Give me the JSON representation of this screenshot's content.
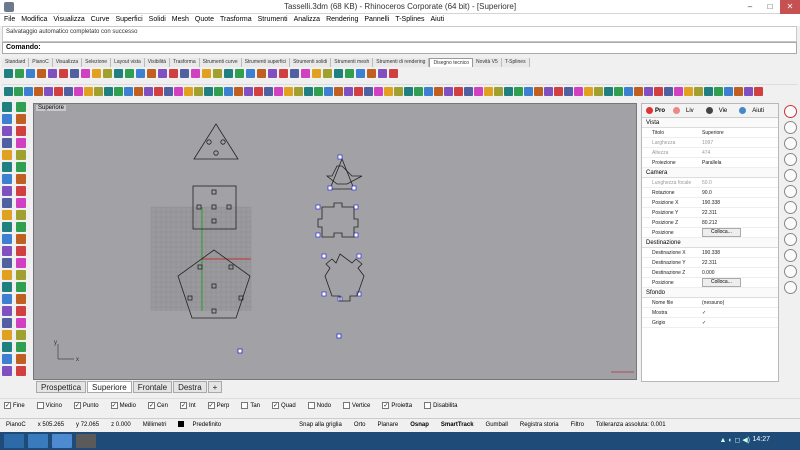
{
  "window": {
    "title": "Tasselli.3dm (68 KB) - Rhinoceros Corporate (64 bit) - [Superiore]",
    "min": "–",
    "max": "□",
    "close": "✕"
  },
  "menu": [
    "File",
    "Modifica",
    "Visualizza",
    "Curve",
    "Superfici",
    "Solidi",
    "Mesh",
    "Quote",
    "Trasforma",
    "Strumenti",
    "Analizza",
    "Rendering",
    "Pannelli",
    "T-Splines",
    "Aiuti"
  ],
  "history": "Salvataggio automatico completato con successo",
  "command": {
    "label": "Comando:",
    "value": ""
  },
  "toolbar_tabs": [
    "Standard",
    "PianoC",
    "Visualizza",
    "Selezione",
    "Layout vista",
    "Visibilità",
    "Trasforma",
    "Strumenti curve",
    "Strumenti superfici",
    "Strumenti solidi",
    "Strumenti mesh",
    "Strumenti di rendering",
    "Disegno tecnico",
    "Novità V5",
    "T-Splines"
  ],
  "active_tab_index": 12,
  "viewport": {
    "label": "Superiore",
    "tabs": [
      "Prospettica",
      "Superiore",
      "Frontale",
      "Destra",
      "+"
    ],
    "active_tab": 1,
    "axis_y": "y",
    "axis_x": "x"
  },
  "panel": {
    "tabs": [
      "Pro",
      "Liv",
      "Vie",
      "Aiuti"
    ],
    "sections": {
      "vista": "Vista",
      "camera": "Camera",
      "destinazione": "Destinazione",
      "sfondo": "Sfondo"
    },
    "vista_rows": [
      {
        "k": "Titolo",
        "v": "Superiore",
        "dim": false
      },
      {
        "k": "Larghezza",
        "v": "1097",
        "dim": true
      },
      {
        "k": "Altezza",
        "v": "474",
        "dim": true
      },
      {
        "k": "Proiezione",
        "v": "Parallela",
        "dim": false
      }
    ],
    "camera_rows": [
      {
        "k": "Lunghezza focale",
        "v": "50.0",
        "dim": true
      },
      {
        "k": "Rotazione",
        "v": "90.0",
        "dim": false
      },
      {
        "k": "Posizione X",
        "v": "190.338",
        "dim": false
      },
      {
        "k": "Posizione Y",
        "v": "22.311",
        "dim": false
      },
      {
        "k": "Posizione Z",
        "v": "80.212",
        "dim": false
      }
    ],
    "camera_pos_label": "Posizione",
    "camera_pos_btn": "Colloca...",
    "dest_rows": [
      {
        "k": "Destinazione X",
        "v": "190.338"
      },
      {
        "k": "Destinazione Y",
        "v": "22.311"
      },
      {
        "k": "Destinazione Z",
        "v": "0.000"
      }
    ],
    "dest_pos_label": "Posizione",
    "dest_pos_btn": "Colloca...",
    "sfondo_rows": [
      {
        "k": "Nome file",
        "v": "(nessuno)"
      },
      {
        "k": "Mostra",
        "v": "✓"
      },
      {
        "k": "Grigio",
        "v": "✓"
      }
    ]
  },
  "osnap": [
    {
      "label": "Fine",
      "on": true
    },
    {
      "label": "Vicino",
      "on": false
    },
    {
      "label": "Punto",
      "on": true
    },
    {
      "label": "Medio",
      "on": true
    },
    {
      "label": "Cen",
      "on": true
    },
    {
      "label": "Int",
      "on": true
    },
    {
      "label": "Perp",
      "on": true
    },
    {
      "label": "Tan",
      "on": false
    },
    {
      "label": "Quad",
      "on": true
    },
    {
      "label": "Nodo",
      "on": false
    },
    {
      "label": "Vertice",
      "on": false
    },
    {
      "label": "Proietta",
      "on": true
    },
    {
      "label": "Disabilita",
      "on": false
    }
  ],
  "status": {
    "plane": "PianoC",
    "x": "x 505.265",
    "y": "y 72.065",
    "z": "z 0.000",
    "units": "Millimetri",
    "layer": "Predefinito",
    "snap_grid": "Snap alla griglia",
    "orto": "Orto",
    "planare": "Planare",
    "osnap": "Osnap",
    "smarttrack": "SmartTrack",
    "gumball": "Gumball",
    "registra": "Registra storia",
    "filtro": "Filtro",
    "tolleranza": "Tolleranza assoluta: 0.001"
  },
  "taskbar": {
    "clock": "14:27",
    "sys": "▲ ◐ ◻ ◀)"
  },
  "colors": {
    "viewport_bg": "#a2a2a6",
    "curve": "#222222",
    "selected": "#2a2ad6",
    "taskbar": "#1e4b78"
  }
}
